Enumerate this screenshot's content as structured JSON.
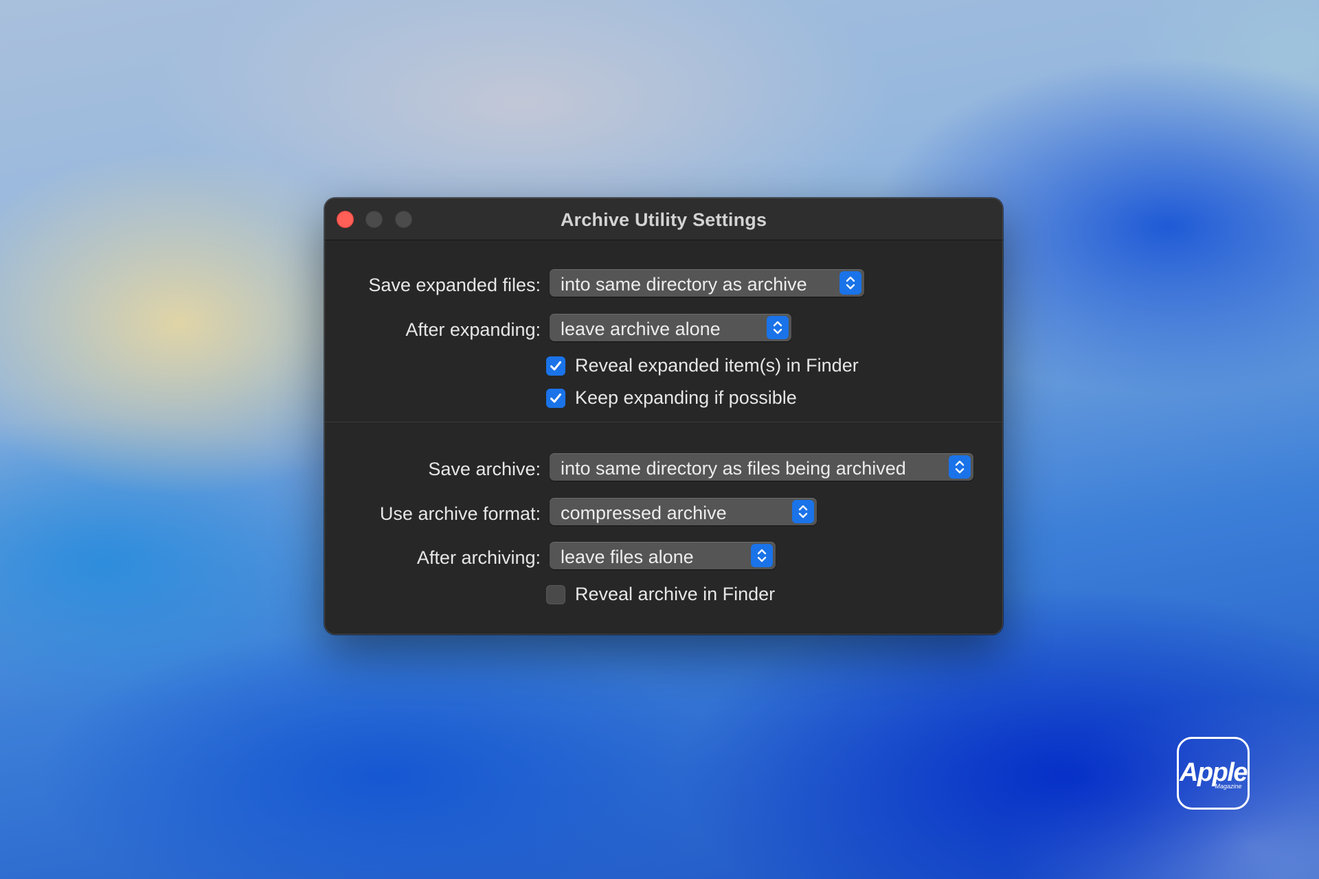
{
  "window": {
    "title": "Archive Utility Settings"
  },
  "expand_section": {
    "save_expanded_files": {
      "label": "Save expanded files:",
      "value": "into same directory as archive"
    },
    "after_expanding": {
      "label": "After expanding:",
      "value": "leave archive alone"
    },
    "reveal_expanded": {
      "label": "Reveal expanded item(s) in Finder",
      "checked": true
    },
    "keep_expanding": {
      "label": "Keep expanding if possible",
      "checked": true
    }
  },
  "archive_section": {
    "save_archive": {
      "label": "Save archive:",
      "value": "into same directory as files being archived"
    },
    "archive_format": {
      "label": "Use archive format:",
      "value": "compressed archive"
    },
    "after_archiving": {
      "label": "After archiving:",
      "value": "leave files alone"
    },
    "reveal_archive": {
      "label": "Reveal archive in Finder",
      "checked": false
    }
  },
  "watermark": {
    "brand": "Apple",
    "sub": "Magazine"
  },
  "colors": {
    "accent": "#1a73e8",
    "close": "#fe5f57",
    "window_bg": "#272727"
  }
}
